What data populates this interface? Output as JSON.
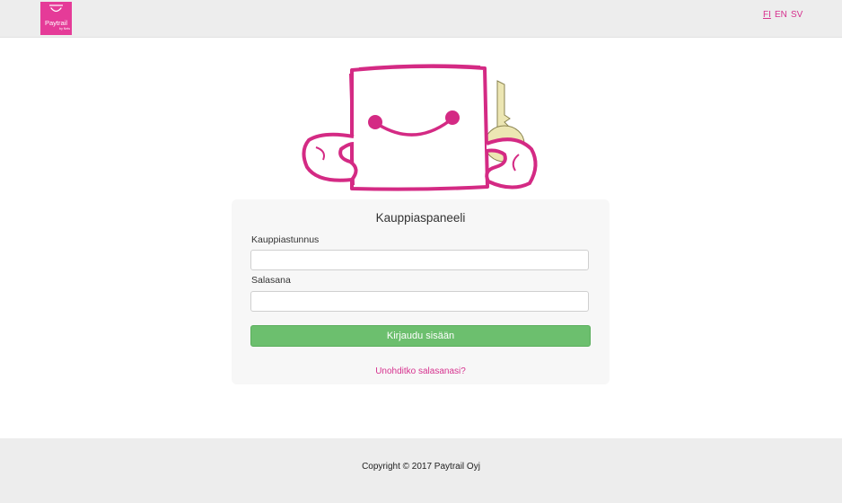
{
  "header": {
    "logo": {
      "brand": "Paytrail",
      "sub": "by Nets",
      "icon": "shopping-bag-smile-icon"
    },
    "languages": [
      {
        "code": "FI",
        "active": true
      },
      {
        "code": "EN",
        "active": false
      },
      {
        "code": "SV",
        "active": false
      }
    ]
  },
  "mascot": {
    "icon": "box-character-with-key-icon"
  },
  "login": {
    "title": "Kauppiaspaneeli",
    "username_label": "Kauppiastunnus",
    "username_value": "",
    "password_label": "Salasana",
    "password_value": "",
    "submit_label": "Kirjaudu sisään",
    "forgot_link": "Unohditko salasanasi?"
  },
  "footer": {
    "copyright": "Copyright © 2017 Paytrail Oyj"
  },
  "colors": {
    "brand_pink": "#e53b98",
    "link_pink": "#d6318e",
    "button_green": "#6cbf6e",
    "header_bg": "#ededed",
    "panel_bg": "#f7f7f7"
  }
}
